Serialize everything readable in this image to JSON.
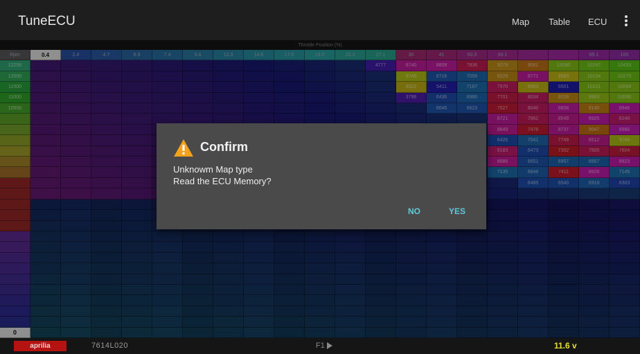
{
  "app": {
    "title": "TuneECU"
  },
  "menu": {
    "items": [
      "Map",
      "Table",
      "ECU"
    ]
  },
  "map": {
    "axis_title": "Throttle Position (%)",
    "corner_label": "Rpm",
    "selected_column_label": "0.4",
    "selected_row_label": "0",
    "columns": [
      "0.4",
      "2.4",
      "4.7",
      "6.9",
      "7.4",
      "9.6",
      "12.3",
      "14.8",
      "17.5",
      "19.5",
      "22.3",
      "27.1",
      "30",
      "41",
      "50.3",
      "60.1",
      "",
      "",
      "85.1",
      "100"
    ],
    "rows": [
      {
        "rpm": "12250",
        "cells": [
          "",
          "",
          "",
          "",
          "",
          "",
          "",
          "",
          "",
          "",
          "",
          "4777",
          "8740",
          "8808",
          "7836",
          "9279",
          "9061",
          "10090",
          "10247",
          "10433"
        ]
      },
      {
        "rpm": "12000",
        "cells": [
          "",
          "",
          "",
          "",
          "",
          "",
          "",
          "",
          "",
          "",
          "",
          "",
          "9745",
          "6716",
          "7056",
          "9229",
          "8771",
          "9583",
          "10104",
          "10273"
        ]
      },
      {
        "rpm": "11500",
        "cells": [
          "",
          "",
          "",
          "",
          "",
          "",
          "",
          "",
          "",
          "",
          "",
          "",
          "9522",
          "5411",
          "7167",
          "7970",
          "9563",
          "5501",
          "10101",
          "10094"
        ]
      },
      {
        "rpm": "11000",
        "cells": [
          "",
          "",
          "",
          "",
          "",
          "",
          "",
          "",
          "",
          "",
          "",
          "",
          "3796",
          "6436",
          "6980",
          "7701",
          "8034",
          "9228",
          "9963",
          "10090"
        ]
      },
      {
        "rpm": "10500",
        "cells": [
          "",
          "",
          "",
          "",
          "",
          "",
          "",
          "",
          "",
          "",
          "",
          "",
          "",
          "6646",
          "6623",
          "7527",
          "8040",
          "8808",
          "9140",
          "8946"
        ]
      },
      {
        "rpm": "",
        "cells": [
          "",
          "",
          "",
          "",
          "",
          "",
          "",
          "",
          "",
          "",
          "",
          "",
          "",
          "",
          "",
          "8721",
          "7962",
          "8549",
          "8925",
          "8240"
        ]
      },
      {
        "rpm": "",
        "cells": [
          "",
          "",
          "",
          "",
          "",
          "",
          "",
          "",
          "",
          "",
          "",
          "",
          "",
          "",
          "",
          "8649",
          "7478",
          "8737",
          "9047",
          "8986"
        ]
      },
      {
        "rpm": "",
        "cells": [
          "",
          "",
          "",
          "",
          "",
          "",
          "",
          "",
          "",
          "",
          "",
          "",
          "",
          "",
          "",
          "6426",
          "7041",
          "7749",
          "8512",
          "9784"
        ]
      },
      {
        "rpm": "",
        "cells": [
          "",
          "",
          "",
          "",
          "",
          "",
          "",
          "",
          "",
          "",
          "",
          "",
          "",
          "",
          "",
          "8183",
          "6473",
          "7352",
          "7905",
          "7604"
        ]
      },
      {
        "rpm": "",
        "cells": [
          "",
          "",
          "",
          "",
          "",
          "",
          "",
          "",
          "",
          "",
          "",
          "",
          "",
          "",
          "",
          "8686",
          "6651",
          "6957",
          "6957",
          "8923"
        ]
      },
      {
        "rpm": "",
        "cells": [
          "",
          "",
          "",
          "",
          "",
          "",
          "",
          "",
          "",
          "",
          "",
          "",
          "",
          "",
          "",
          "7135",
          "6846",
          "7411",
          "8926",
          "7145"
        ]
      },
      {
        "rpm": "",
        "cells": [
          "",
          "",
          "",
          "",
          "",
          "",
          "",
          "",
          "",
          "",
          "",
          "",
          "",
          "",
          "",
          "",
          "6485",
          "6540",
          "6918",
          "6303"
        ]
      }
    ]
  },
  "dialog": {
    "title": "Confirm",
    "message_line1": "Unknowm Map type",
    "message_line2": "Read the ECU Memory?",
    "no_label": "NO",
    "yes_label": "YES",
    "icon": "warning-icon"
  },
  "status": {
    "brand": "aprilia",
    "ecu_id": "7614L020",
    "fkey": "F1",
    "voltage": "11.6 v"
  },
  "colors": {
    "accent": "#5fc9d7",
    "voltage": "#e7e032",
    "brand_bg": "#b51212"
  }
}
